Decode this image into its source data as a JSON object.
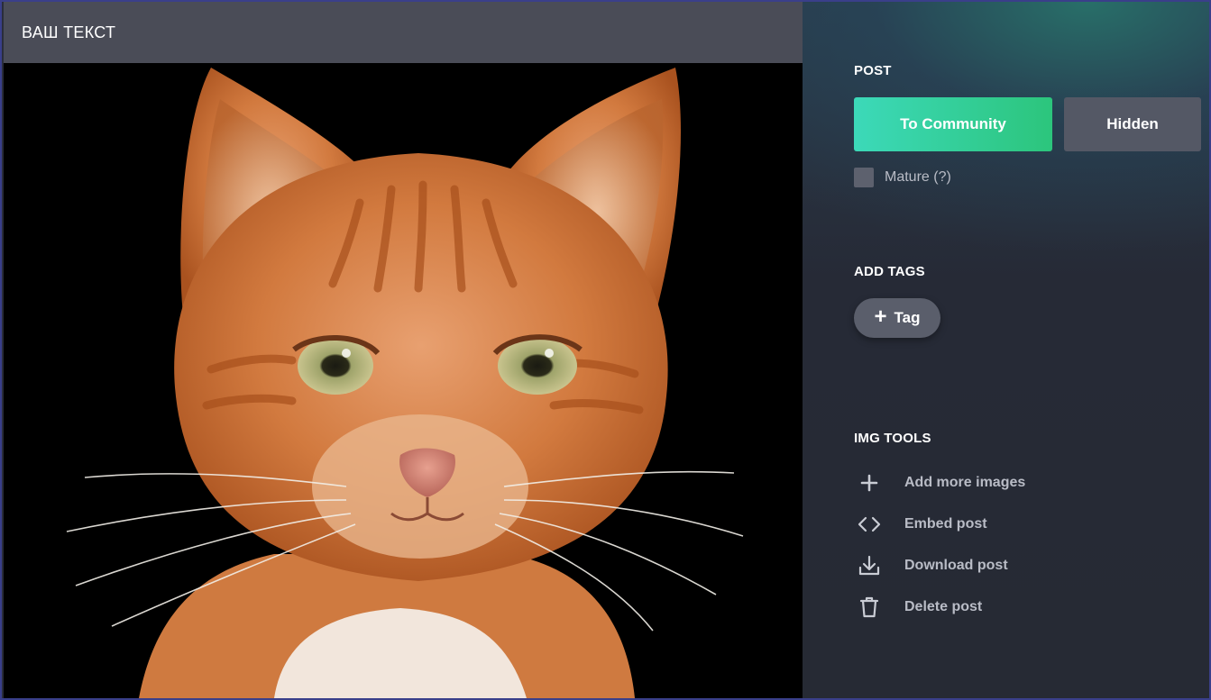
{
  "editor": {
    "title": "ВАШ ТЕКСТ"
  },
  "sidebar": {
    "post": {
      "title": "POST",
      "community_label": "To Community",
      "hidden_label": "Hidden",
      "mature_label": "Mature (?)"
    },
    "tags": {
      "title": "ADD TAGS",
      "add_label": "Tag",
      "add_icon": "plus-icon"
    },
    "img_tools": {
      "title": "IMG TOOLS",
      "items": [
        {
          "label": "Add more images",
          "icon": "plus-icon"
        },
        {
          "label": "Embed post",
          "icon": "code-icon"
        },
        {
          "label": "Download post",
          "icon": "download-icon"
        },
        {
          "label": "Delete post",
          "icon": "trash-icon"
        }
      ]
    }
  },
  "colors": {
    "accent_start": "#3cd9b9",
    "accent_end": "#2cc57c",
    "sidebar_bg": "#262a36",
    "title_bar_bg": "#4a4c57"
  }
}
